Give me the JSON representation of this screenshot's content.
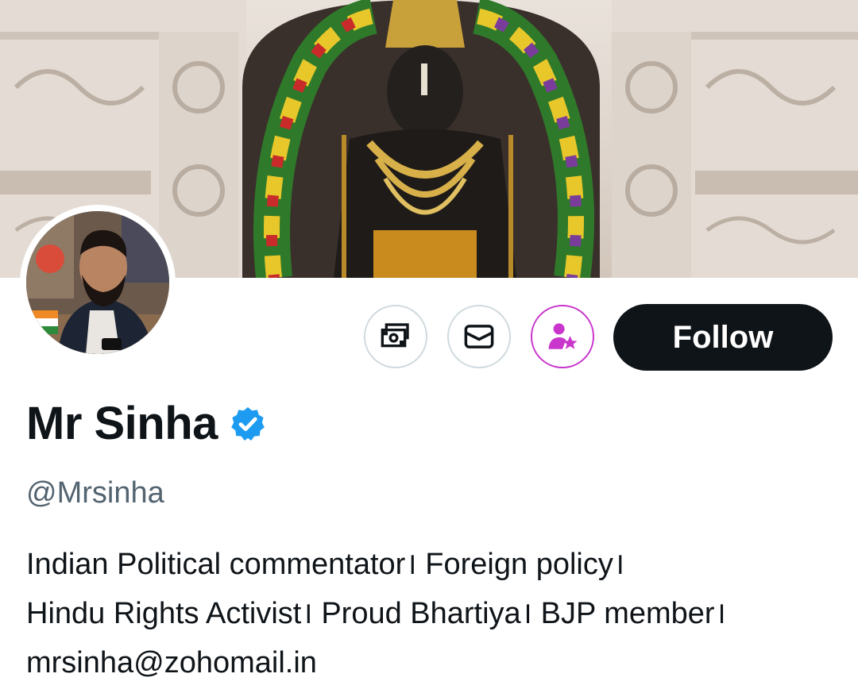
{
  "profile": {
    "name": "Mr Sinha",
    "handle": "@Mrsinha",
    "bio_lines": [
      "Indian Political commentator। Foreign policy।",
      "Hindu Rights Activist। Proud Bhartiya। BJP member।",
      "mrsinha@zohomail.in"
    ],
    "verified": true
  },
  "actions": {
    "follow_label": "Follow",
    "icons": [
      "tip-money-icon",
      "message-mail-icon",
      "subscribe-person-star-icon"
    ]
  },
  "colors": {
    "verified_blue": "#1d9bf0",
    "subscribe_accent": "#c936cc",
    "follow_bg": "#0f1419",
    "handle_gray": "#536471"
  }
}
